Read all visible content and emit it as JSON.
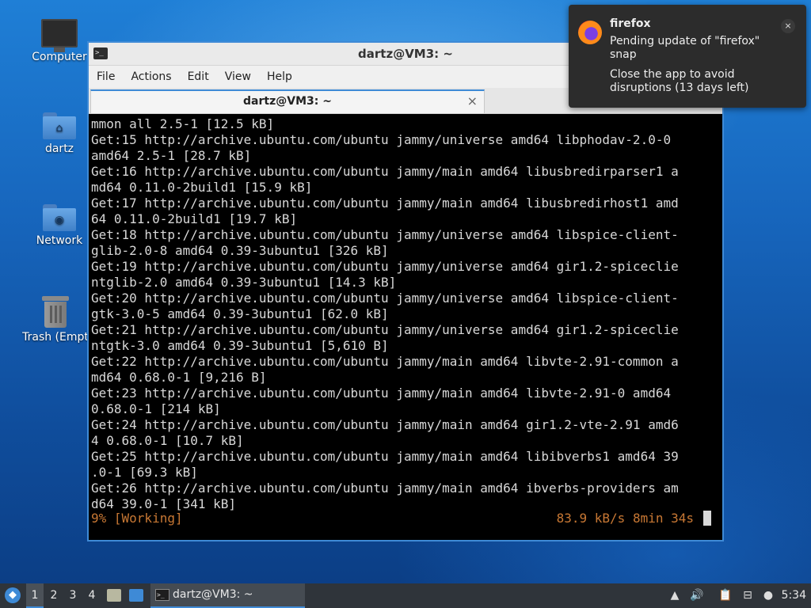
{
  "desktop": {
    "icons": [
      {
        "label": "Computer"
      },
      {
        "label": "dartz"
      },
      {
        "label": "Network"
      },
      {
        "label": "Trash (Empt"
      }
    ]
  },
  "window": {
    "title": "dartz@VM3: ~",
    "menu": [
      "File",
      "Actions",
      "Edit",
      "View",
      "Help"
    ],
    "tab_label": "dartz@VM3: ~",
    "tab_close": "×"
  },
  "terminal": {
    "lines": [
      "mmon all 2.5-1 [12.5 kB]",
      "Get:15 http://archive.ubuntu.com/ubuntu jammy/universe amd64 libphodav-2.0-0",
      "amd64 2.5-1 [28.7 kB]",
      "Get:16 http://archive.ubuntu.com/ubuntu jammy/main amd64 libusbredirparser1 a",
      "md64 0.11.0-2build1 [15.9 kB]",
      "Get:17 http://archive.ubuntu.com/ubuntu jammy/main amd64 libusbredirhost1 amd",
      "64 0.11.0-2build1 [19.7 kB]",
      "Get:18 http://archive.ubuntu.com/ubuntu jammy/universe amd64 libspice-client-",
      "glib-2.0-8 amd64 0.39-3ubuntu1 [326 kB]",
      "Get:19 http://archive.ubuntu.com/ubuntu jammy/universe amd64 gir1.2-spiceclie",
      "ntglib-2.0 amd64 0.39-3ubuntu1 [14.3 kB]",
      "Get:20 http://archive.ubuntu.com/ubuntu jammy/universe amd64 libspice-client-",
      "gtk-3.0-5 amd64 0.39-3ubuntu1 [62.0 kB]",
      "Get:21 http://archive.ubuntu.com/ubuntu jammy/universe amd64 gir1.2-spiceclie",
      "ntgtk-3.0 amd64 0.39-3ubuntu1 [5,610 B]",
      "Get:22 http://archive.ubuntu.com/ubuntu jammy/main amd64 libvte-2.91-common a",
      "md64 0.68.0-1 [9,216 B]",
      "Get:23 http://archive.ubuntu.com/ubuntu jammy/main amd64 libvte-2.91-0 amd64",
      "0.68.0-1 [214 kB]",
      "Get:24 http://archive.ubuntu.com/ubuntu jammy/main amd64 gir1.2-vte-2.91 amd6",
      "4 0.68.0-1 [10.7 kB]",
      "Get:25 http://archive.ubuntu.com/ubuntu jammy/main amd64 libibverbs1 amd64 39",
      ".0-1 [69.3 kB]",
      "Get:26 http://archive.ubuntu.com/ubuntu jammy/main amd64 ibverbs-providers am",
      "d64 39.0-1 [341 kB]"
    ],
    "status_left": "9% [Working]",
    "status_right": "83.9 kB/s 8min 34s"
  },
  "notification": {
    "app": "firefox",
    "body": "Pending update of \"firefox\" snap",
    "detail": "Close the app to avoid disruptions (13 days left)",
    "close": "×"
  },
  "taskbar": {
    "workspaces": [
      "1",
      "2",
      "3",
      "4"
    ],
    "active_workspace": "1",
    "task_label": "dartz@VM3: ~",
    "clock": "5:34"
  },
  "colors": {
    "accent": "#3e8ad6",
    "terminal_bg": "#000000",
    "terminal_fg": "#d8d8d8",
    "status_text": "#c87834",
    "notification_bg": "#2c2c2c",
    "taskbar_bg": "#2f343a"
  }
}
